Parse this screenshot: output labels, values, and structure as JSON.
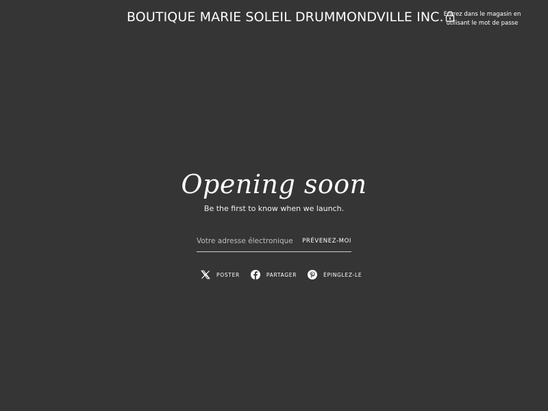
{
  "header": {
    "store_title": "BOUTIQUE MARIE SOLEIL DRUMMONDVILLE INC.",
    "password_entry_line1": "Entrez dans le magasin en",
    "password_entry_line2": "utilisant le mot de passe"
  },
  "hero": {
    "title": "Opening soon",
    "subtitle": "Be the first to know when we launch."
  },
  "signup": {
    "email_placeholder": "Votre adresse électronique",
    "email_value": "",
    "submit_label": "PRÉVENEZ-MOI"
  },
  "share": {
    "items": [
      {
        "label": "POSTER",
        "icon": "x-icon"
      },
      {
        "label": "PARTAGER",
        "icon": "facebook-icon"
      },
      {
        "label": "ÉPINGLEZ-LE",
        "icon": "pinterest-icon"
      }
    ]
  },
  "colors": {
    "background": "#353535",
    "text": "#ffffff",
    "input_underline": "#cfcfcf"
  }
}
